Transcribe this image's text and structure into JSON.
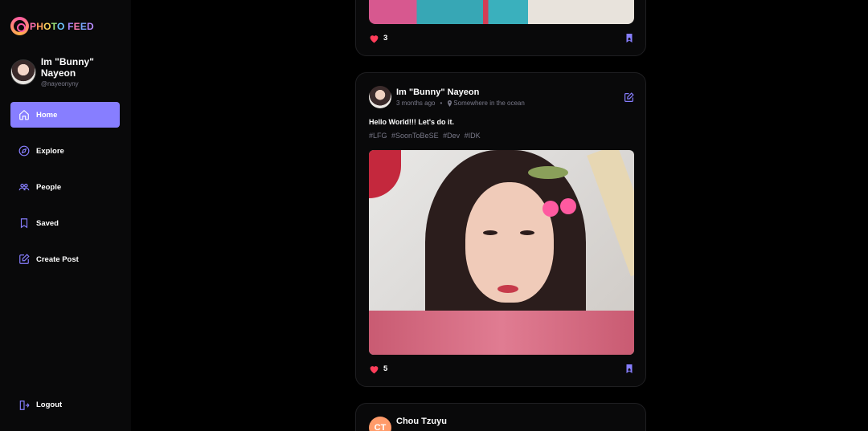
{
  "app": {
    "logo_letters": [
      "P",
      "H",
      "O",
      "T",
      "O",
      " ",
      "F",
      "E",
      "E",
      "D"
    ]
  },
  "profile": {
    "name": "Im \"Bunny\" Nayeon",
    "handle": "@nayeonyny"
  },
  "nav": {
    "items": [
      {
        "label": "Home",
        "icon": "home-icon",
        "active": true
      },
      {
        "label": "Explore",
        "icon": "compass-icon"
      },
      {
        "label": "People",
        "icon": "people-icon"
      },
      {
        "label": "Saved",
        "icon": "bookmark-icon"
      },
      {
        "label": "Create Post",
        "icon": "edit-icon"
      }
    ],
    "logout": "Logout"
  },
  "colors": {
    "accent": "#877eff",
    "heart": "#ff3d5a",
    "muted": "#7a7a8a",
    "background": "#000000",
    "card": "#09090a"
  },
  "feed": {
    "posts": [
      {
        "likes": "3"
      },
      {
        "author": "Im \"Bunny\" Nayeon",
        "time": "3 months ago",
        "location": "Somewhere in the ocean",
        "caption": "Hello World!!! Let's do it.",
        "tags": [
          "#LFG",
          "#SoonToBeSE",
          "#Dev",
          "#IDK"
        ],
        "likes": "5"
      },
      {
        "author": "Chou Tzuyu",
        "initials": "CT"
      }
    ]
  }
}
